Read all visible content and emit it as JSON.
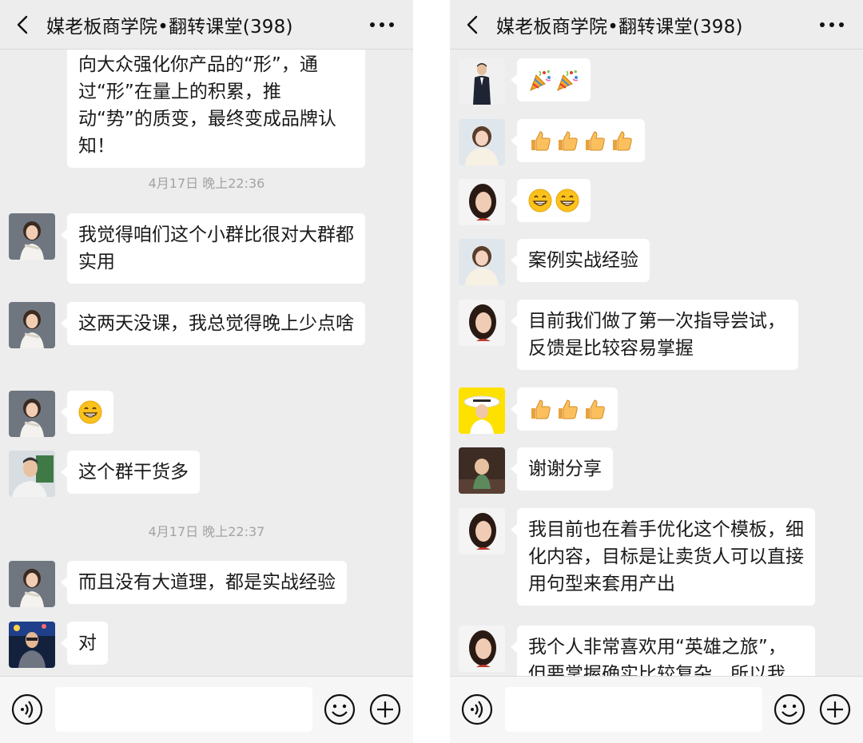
{
  "left": {
    "header": {
      "title": "媒老板商学院•翻转课堂(398)"
    },
    "messages": [
      {
        "text": "向大众强化你产品的“形”，通过“形”在量上的积累，推动“势”的质变，最终变成品牌认知！"
      },
      {
        "text": "我觉得咱们这个小群比很对大群都实用"
      },
      {
        "text": "这两天没课，我总觉得晚上少点啥"
      },
      {
        "text": "这个群干货多"
      },
      {
        "text": "而且没有大道理，都是实战经验"
      },
      {
        "text": "对"
      }
    ],
    "timestamps": [
      "4月17日 晚上22:36",
      "4月17日 晚上22:37"
    ],
    "icons": {
      "back": "chevron-left-icon",
      "more": "more-dots-icon",
      "voice": "voice-icon",
      "emoji": "smile-icon",
      "plus": "plus-icon"
    }
  },
  "right": {
    "header": {
      "title": "媒老板商学院•翻转课堂(398)"
    },
    "messages": [
      {
        "emojis": [
          "party-popper",
          "party-popper"
        ]
      },
      {
        "emojis": [
          "thumbs-up",
          "thumbs-up",
          "thumbs-up",
          "thumbs-up"
        ]
      },
      {
        "emojis": [
          "grin",
          "grin"
        ]
      },
      {
        "text": "案例实战经验"
      },
      {
        "text": "目前我们做了第一次指导尝试，反馈是比较容易掌握"
      },
      {
        "emojis": [
          "thumbs-up",
          "thumbs-up",
          "thumbs-up"
        ]
      },
      {
        "text": "谢谢分享"
      },
      {
        "text": "我目前也在着手优化这个模板，细化内容，目标是让卖货人可以直接用句型来套用产出"
      },
      {
        "text": "我个人非常喜欢用“英雄之旅”，但要掌握确实比较复杂，所以我"
      }
    ],
    "emojis_left": [
      "grin"
    ]
  },
  "colors": {
    "background": "#ededed",
    "bubble": "#ffffff",
    "timestamp": "#a3a3a3",
    "text": "#1a1a1a"
  }
}
